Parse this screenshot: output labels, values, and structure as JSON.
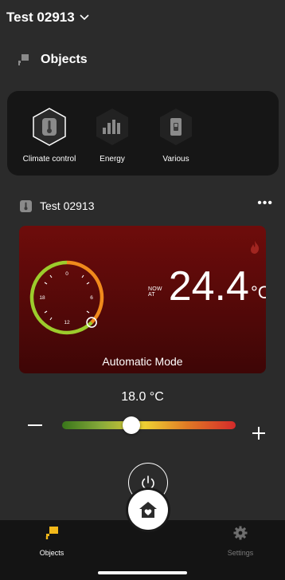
{
  "header": {
    "title": "Test 02913"
  },
  "section": {
    "title": "Objects"
  },
  "categories": [
    {
      "label": "Climate control",
      "icon": "thermometer-icon"
    },
    {
      "label": "Energy",
      "icon": "energy-bars-icon"
    },
    {
      "label": "Various",
      "icon": "switch-icon"
    }
  ],
  "device": {
    "name": "Test 02913",
    "more": "•••"
  },
  "climate_card": {
    "now_at_label": "NOW AT",
    "current_temp": "24.4",
    "unit": "°C",
    "mode": "Automatic Mode",
    "dial_labels": [
      "0",
      "6",
      "12",
      "18"
    ],
    "flame_icon": "flame-icon",
    "colors": {
      "card_top": "#6e0c0b",
      "card_bottom": "#3e0606",
      "dial_green": "#9ccc2c",
      "dial_orange": "#f08a1c"
    }
  },
  "setpoint": {
    "label": "18.0 °C",
    "slider_fraction": 0.4
  },
  "controls": {
    "minus": "−",
    "plus": "+",
    "power_icon": "power-icon"
  },
  "tabbar": {
    "items": [
      {
        "label": "Objects",
        "icon": "objects-icon",
        "active": true
      },
      {
        "label": "Settings",
        "icon": "gear-icon",
        "active": false
      }
    ],
    "center_icon": "home-heart-icon"
  }
}
